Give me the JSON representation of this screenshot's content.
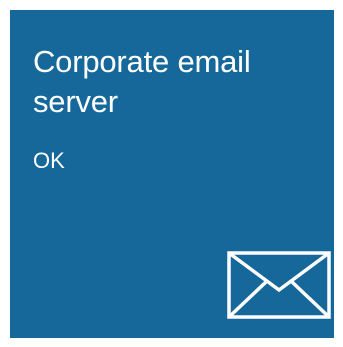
{
  "tile": {
    "title": "Corporate email server",
    "status": "OK",
    "icon": "envelope-icon",
    "background_color": "#17689a",
    "text_color": "#ffffff"
  }
}
